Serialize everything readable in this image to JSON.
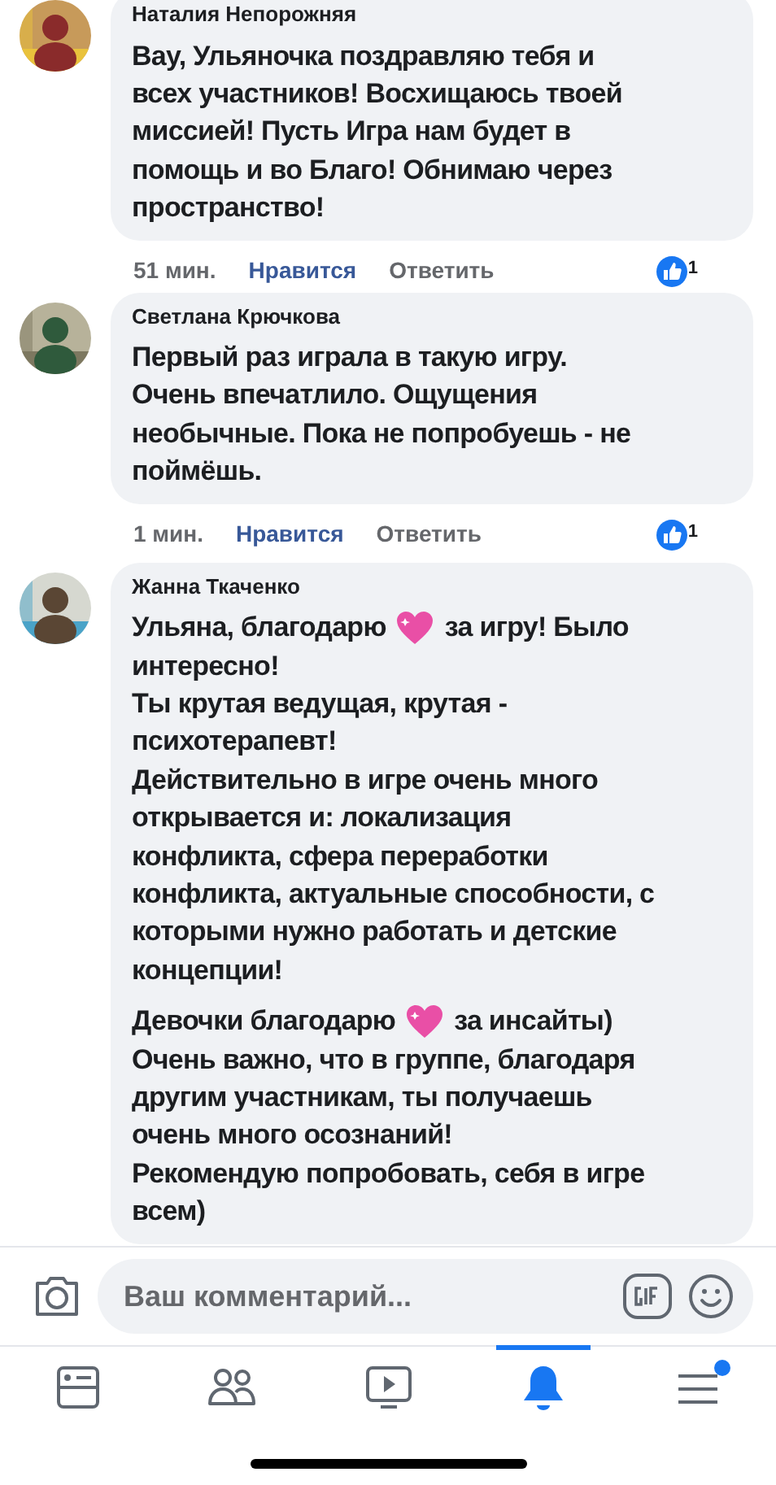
{
  "comments": [
    {
      "author": "Наталия Непорожняя",
      "paragraphs": [
        [
          [
            {
              "kind": "text",
              "text": "Вау, Ульяночка поздравляю тебя и"
            }
          ],
          [
            {
              "kind": "text",
              "text": "всех участников! Восхищаюсь твоей"
            }
          ],
          [
            {
              "kind": "text",
              "text": "миссией! Пусть Игра нам будет  в"
            }
          ],
          [
            {
              "kind": "text",
              "text": "помощь и во Благо! Обнимаю через"
            }
          ],
          [
            {
              "kind": "text",
              "text": "пространство!"
            }
          ]
        ]
      ],
      "time": "51 мин.",
      "like": "Нравится",
      "liked": true,
      "reply": "Ответить",
      "reactions": "1"
    },
    {
      "author": "Светлана Крючкова",
      "paragraphs": [
        [
          [
            {
              "kind": "text",
              "text": "Первый раз играла в такую игру."
            }
          ],
          [
            {
              "kind": "text",
              "text": "Очень впечатлило. Ощущения"
            }
          ],
          [
            {
              "kind": "text",
              "text": "необычные. Пока не попробуешь - не"
            }
          ],
          [
            {
              "kind": "text",
              "text": "поймёшь."
            }
          ]
        ]
      ],
      "time": "1 мин.",
      "like": "Нравится",
      "liked": true,
      "reply": "Ответить",
      "reactions": "1"
    },
    {
      "author": "Жанна Ткаченко",
      "paragraphs": [
        [
          [
            {
              "kind": "text",
              "text": "Ульяна, благодарю"
            },
            {
              "kind": "icon"
            },
            {
              "kind": "text",
              "text": "за игру! Было"
            }
          ],
          [
            {
              "kind": "text",
              "text": "интересно!"
            }
          ],
          [
            {
              "kind": "text",
              "text": "Ты крутая ведущая, крутая -"
            }
          ],
          [
            {
              "kind": "text",
              "text": "психотерапевт!"
            }
          ],
          [
            {
              "kind": "text",
              "text": "Действительно в игре очень много"
            }
          ],
          [
            {
              "kind": "text",
              "text": "открывается и: локализация"
            }
          ],
          [
            {
              "kind": "text",
              "text": "конфликта, сфера переработки"
            }
          ],
          [
            {
              "kind": "text",
              "text": "конфликта, актуальные способности, с"
            }
          ],
          [
            {
              "kind": "text",
              "text": "которыми нужно работать и детские"
            }
          ],
          [
            {
              "kind": "text",
              "text": "концепции!"
            }
          ]
        ],
        [
          [
            {
              "kind": "text",
              "text": "Девочки благодарю"
            },
            {
              "kind": "icon"
            },
            {
              "kind": "text",
              "text": "за инсайты)"
            }
          ],
          [
            {
              "kind": "text",
              "text": "Очень важно, что в группе, благодаря"
            }
          ],
          [
            {
              "kind": "text",
              "text": "другим участникам, ты получаешь"
            }
          ],
          [
            {
              "kind": "text",
              "text": "очень много осознаний!"
            }
          ],
          [
            {
              "kind": "text",
              "text": "Рекомендую попробовать, себя в игре"
            }
          ],
          [
            {
              "kind": "text",
              "text": "всем)"
            }
          ]
        ]
      ]
    }
  ],
  "composer": {
    "placeholder": "Ваш комментарий..."
  },
  "tab_bar": [
    {
      "kind": "feed",
      "selected": false,
      "badge": false
    },
    {
      "kind": "groups",
      "selected": false,
      "badge": false
    },
    {
      "kind": "video",
      "selected": false,
      "badge": false
    },
    {
      "kind": "notifications",
      "selected": true,
      "badge": false
    },
    {
      "kind": "menu",
      "selected": false,
      "badge": true
    }
  ]
}
